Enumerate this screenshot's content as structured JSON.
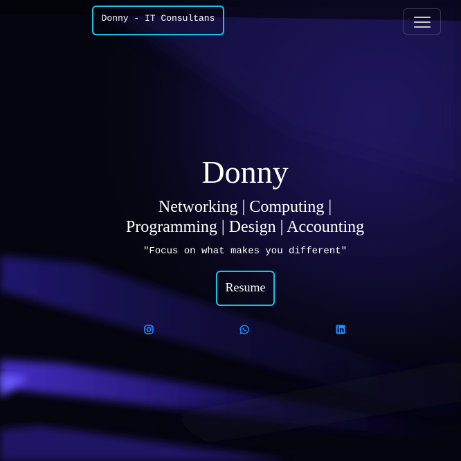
{
  "navbar": {
    "brand": "Donny - IT Consultans",
    "toggle_icon": "hamburger-menu-icon"
  },
  "hero": {
    "title": "Donny",
    "subtitle": "Networking | Computing | Programming | Design | Accounting",
    "quote": "\"Focus on what makes you different\"",
    "resume_label": "Resume"
  },
  "social": [
    {
      "icon": "instagram-icon"
    },
    {
      "icon": "whatsapp-icon"
    },
    {
      "icon": "linkedin-icon"
    }
  ],
  "colors": {
    "accent_border": "#19c3e6",
    "icon_blue": "#1f8fff",
    "background": "#05050f"
  }
}
